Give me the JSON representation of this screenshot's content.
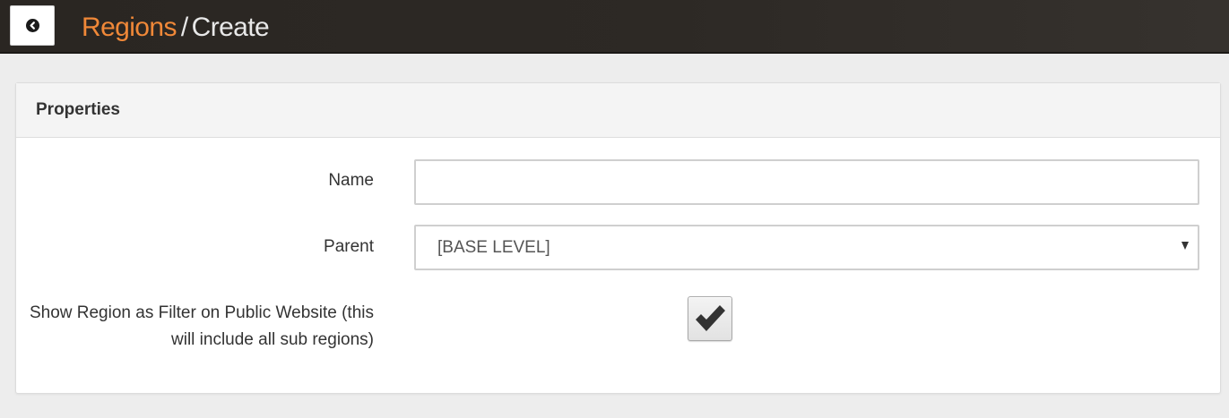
{
  "header": {
    "back_icon": "circle-arrow-left-icon",
    "breadcrumb_link": "Regions",
    "breadcrumb_separator": "/",
    "breadcrumb_current": "Create",
    "accent_color": "#f08838",
    "bar_color": "#2d2925"
  },
  "panel": {
    "title": "Properties",
    "fields": {
      "name": {
        "label": "Name",
        "value": "",
        "placeholder": ""
      },
      "parent": {
        "label": "Parent",
        "selected": "[BASE LEVEL]",
        "caret_icon": "caret-down-icon"
      },
      "show_filter": {
        "label": "Show Region as Filter on Public Website (this will include all sub regions)",
        "checked": true,
        "check_icon": "checkmark-icon"
      }
    }
  }
}
